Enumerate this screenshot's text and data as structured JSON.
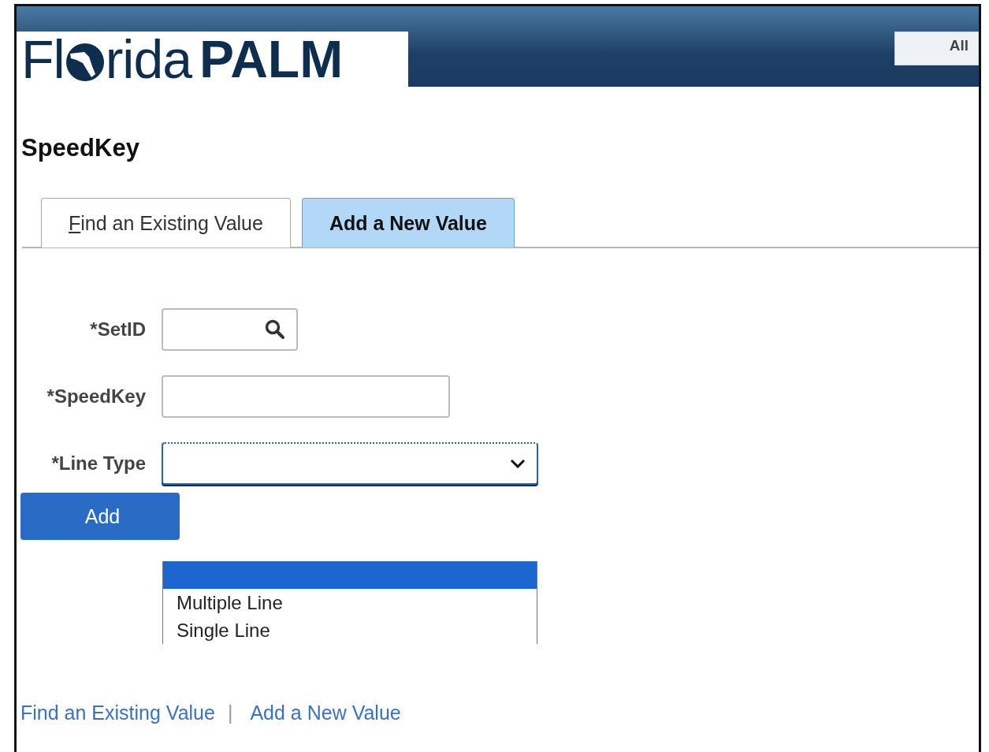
{
  "header": {
    "logo": {
      "light_start": "Fl",
      "light_end": "rida",
      "bold": "PALM"
    },
    "search_scope": "All"
  },
  "page_title": "SpeedKey",
  "tabs": [
    {
      "label": "Find an Existing Value",
      "selected": false,
      "mnemonic_first": true
    },
    {
      "label": "Add a New Value",
      "selected": true,
      "mnemonic_first": false
    }
  ],
  "fields": [
    {
      "kind": "lookup",
      "label": "*SetID"
    },
    {
      "kind": "text",
      "label": "*SpeedKey"
    },
    {
      "kind": "select",
      "label": "*Line Type",
      "focused": true,
      "open": true,
      "options": [
        {
          "selected": true
        },
        {
          "label": "Multiple Line",
          "selected": false
        },
        {
          "label": "Single Line",
          "selected": false
        }
      ]
    }
  ],
  "add_button": "Add",
  "footer_links": [
    "Find an Existing Value",
    "Add a New Value"
  ],
  "footer_separator": "|"
}
